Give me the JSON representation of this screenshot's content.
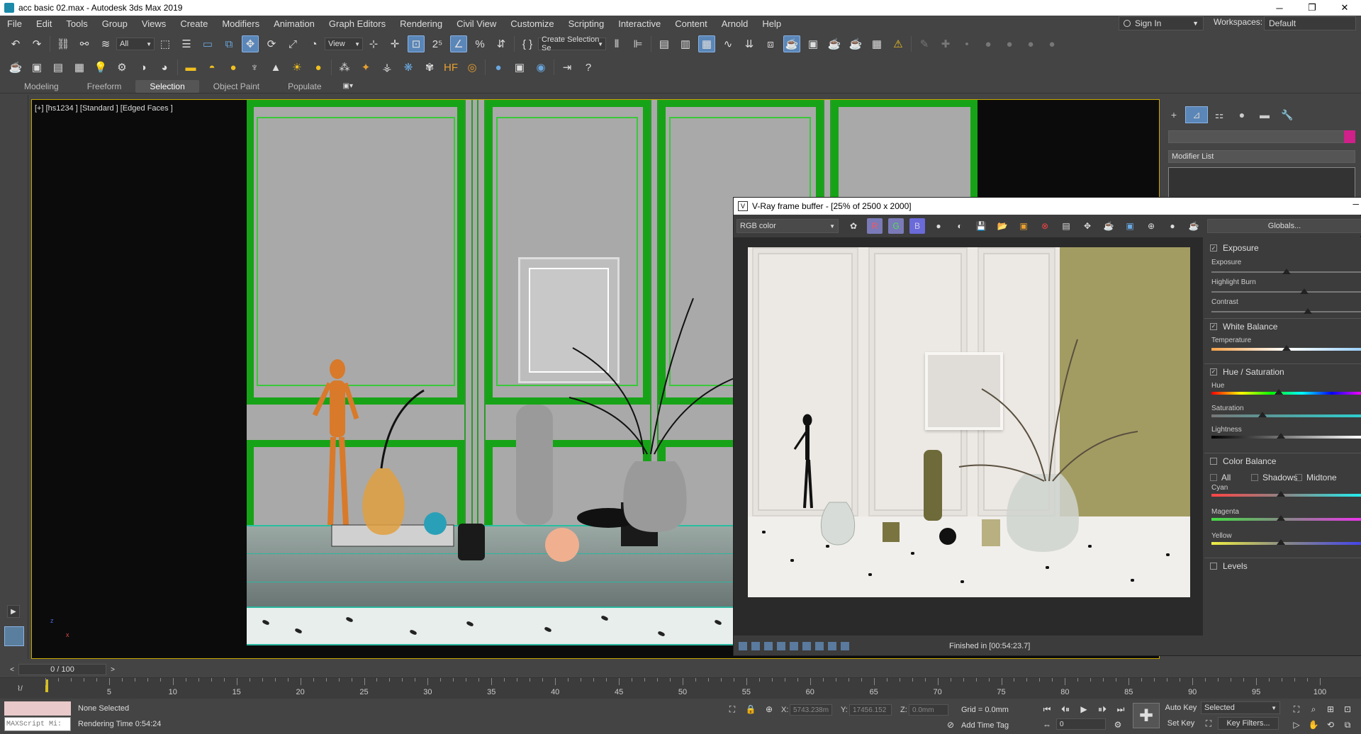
{
  "window": {
    "title": "acc basic 02.max - Autodesk 3ds Max 2019",
    "min_icon": "─",
    "max_icon": "❐",
    "close_icon": "✕"
  },
  "menu": {
    "items": [
      "File",
      "Edit",
      "Tools",
      "Group",
      "Views",
      "Create",
      "Modifiers",
      "Animation",
      "Graph Editors",
      "Rendering",
      "Civil View",
      "Customize",
      "Scripting",
      "Interactive",
      "Content",
      "Arnold",
      "Help"
    ],
    "sign_in": "Sign In",
    "workspaces_label": "Workspaces:",
    "workspace_value": "Default"
  },
  "toolbar": {
    "filter_value": "All",
    "ref_coord_value": "View",
    "named_selection_value": "Create Selection Se"
  },
  "ribbon": {
    "tabs": [
      "Modeling",
      "Freeform",
      "Selection",
      "Object Paint",
      "Populate"
    ],
    "active_tab": "Selection"
  },
  "viewport": {
    "label": "[+] [hs1234 ] [Standard ] [Edged Faces ]",
    "axis_z": "z",
    "axis_x": "x"
  },
  "command_panel": {
    "modifier_list": "Modifier List",
    "accent_color": "#d0208a"
  },
  "vray": {
    "title": "V-Ray frame buffer - [25% of 2500 x 2000]",
    "channel": "RGB color",
    "globals": "Globals...",
    "status": "Finished in [00:54:23.7]",
    "sections": {
      "exposure": "Exposure",
      "white_balance": "White Balance",
      "hue_saturation": "Hue / Saturation",
      "color_balance": "Color Balance",
      "levels": "Levels"
    },
    "sliders": {
      "exposure": "Exposure",
      "highlight_burn": "Highlight Burn",
      "contrast": "Contrast",
      "temperature": "Temperature",
      "hue": "Hue",
      "saturation": "Saturation",
      "lightness": "Lightness",
      "cyan": "Cyan",
      "magenta": "Magenta",
      "yellow": "Yellow"
    },
    "color_balance_opts": {
      "all": "All",
      "shadows": "Shadows",
      "midtones": "Midtone"
    },
    "slider_levels": {
      "exposure": 0.5,
      "highlight_burn": 0.62,
      "contrast": 0.64,
      "temperature": 0.5,
      "hue": 0.45,
      "saturation": 0.34,
      "lightness": 0.46,
      "cyan": 0.46,
      "magenta": 0.46,
      "yellow": 0.46
    }
  },
  "timeline": {
    "frame_display": "0 / 100",
    "ticks": [
      0,
      5,
      10,
      15,
      20,
      25,
      30,
      35,
      40,
      45,
      50,
      55,
      60,
      65,
      70,
      75,
      80,
      85,
      90,
      95,
      100
    ]
  },
  "status": {
    "maxscript": "MAXScript Mi:",
    "selection": "None Selected",
    "render_time": "Rendering Time  0:54:24",
    "x_label": "X:",
    "x_value": "5743.238m",
    "y_label": "Y:",
    "y_value": "17456.152",
    "z_label": "Z:",
    "z_value": "0.0mm",
    "grid": "Grid = 0.0mm",
    "add_time_tag": "Add Time Tag",
    "auto_key": "Auto Key",
    "set_key": "Set Key",
    "selected": "Selected",
    "key_filters": "Key Filters...",
    "frame_value": "0"
  }
}
